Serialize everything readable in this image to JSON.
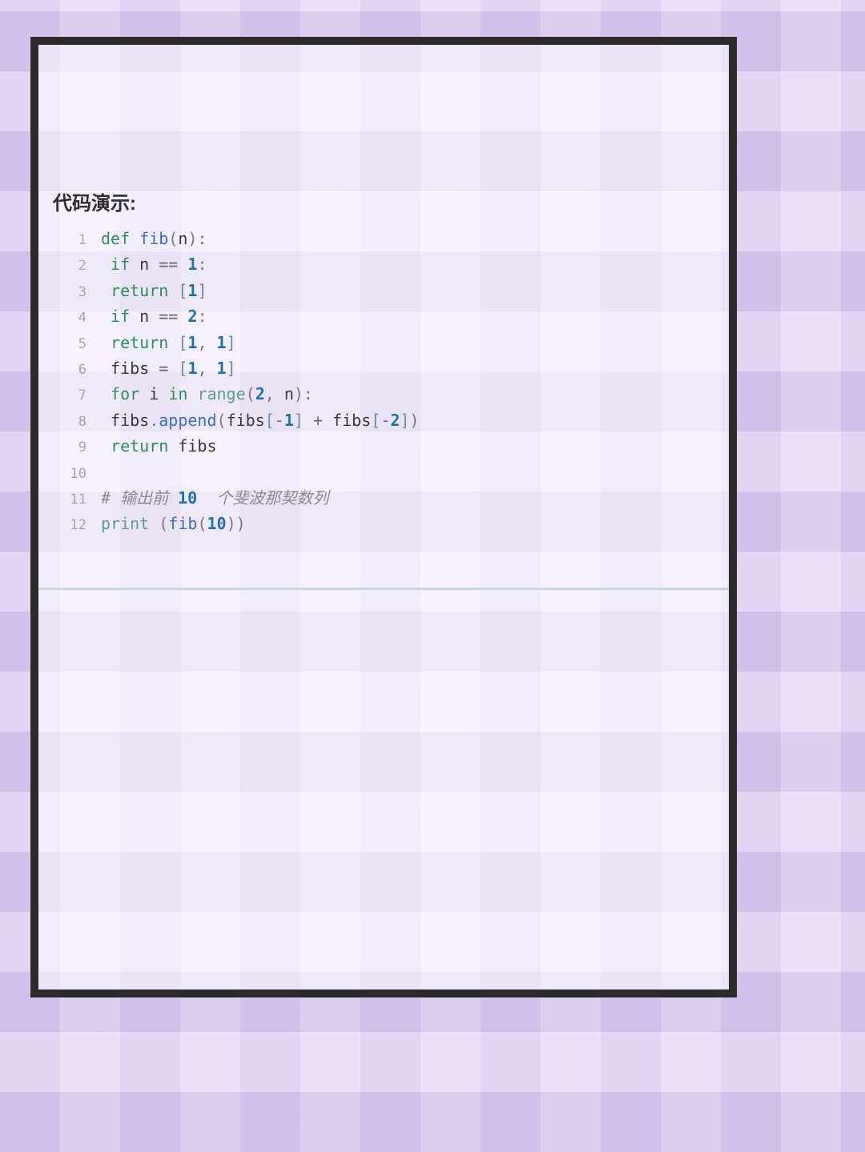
{
  "heading": "代码演示:",
  "code": {
    "line_numbers": [
      "1",
      "2",
      "3",
      "4",
      "5",
      "6",
      "7",
      "8",
      "9",
      "10",
      "11",
      "12"
    ],
    "lines": [
      [
        {
          "cls": "tok-kw",
          "t": "def "
        },
        {
          "cls": "tok-fn",
          "t": "fib"
        },
        {
          "cls": "tok-pun",
          "t": "("
        },
        {
          "cls": "tok-var",
          "t": "n"
        },
        {
          "cls": "tok-pun",
          "t": "):"
        }
      ],
      [
        {
          "cls": "",
          "t": " "
        },
        {
          "cls": "tok-kw",
          "t": "if "
        },
        {
          "cls": "tok-var",
          "t": "n "
        },
        {
          "cls": "tok-op",
          "t": "== "
        },
        {
          "cls": "tok-num",
          "t": "1"
        },
        {
          "cls": "tok-pun",
          "t": ":"
        }
      ],
      [
        {
          "cls": "",
          "t": " "
        },
        {
          "cls": "tok-kw",
          "t": "return "
        },
        {
          "cls": "tok-br",
          "t": "["
        },
        {
          "cls": "tok-num",
          "t": "1"
        },
        {
          "cls": "tok-br",
          "t": "]"
        }
      ],
      [
        {
          "cls": "",
          "t": " "
        },
        {
          "cls": "tok-kw",
          "t": "if "
        },
        {
          "cls": "tok-var",
          "t": "n "
        },
        {
          "cls": "tok-op",
          "t": "== "
        },
        {
          "cls": "tok-num",
          "t": "2"
        },
        {
          "cls": "tok-pun",
          "t": ":"
        }
      ],
      [
        {
          "cls": "",
          "t": " "
        },
        {
          "cls": "tok-kw",
          "t": "return "
        },
        {
          "cls": "tok-br",
          "t": "["
        },
        {
          "cls": "tok-num",
          "t": "1"
        },
        {
          "cls": "tok-pun",
          "t": ", "
        },
        {
          "cls": "tok-num",
          "t": "1"
        },
        {
          "cls": "tok-br",
          "t": "]"
        }
      ],
      [
        {
          "cls": "",
          "t": " "
        },
        {
          "cls": "tok-var",
          "t": "fibs "
        },
        {
          "cls": "tok-op",
          "t": "= "
        },
        {
          "cls": "tok-br",
          "t": "["
        },
        {
          "cls": "tok-num",
          "t": "1"
        },
        {
          "cls": "tok-pun",
          "t": ", "
        },
        {
          "cls": "tok-num",
          "t": "1"
        },
        {
          "cls": "tok-br",
          "t": "]"
        }
      ],
      [
        {
          "cls": "",
          "t": " "
        },
        {
          "cls": "tok-kw",
          "t": "for "
        },
        {
          "cls": "tok-var",
          "t": "i "
        },
        {
          "cls": "tok-kw",
          "t": "in "
        },
        {
          "cls": "tok-bi",
          "t": "range"
        },
        {
          "cls": "tok-pun",
          "t": "("
        },
        {
          "cls": "tok-num",
          "t": "2"
        },
        {
          "cls": "tok-pun",
          "t": ", "
        },
        {
          "cls": "tok-var",
          "t": "n"
        },
        {
          "cls": "tok-pun",
          "t": "):"
        }
      ],
      [
        {
          "cls": "",
          "t": " "
        },
        {
          "cls": "tok-var",
          "t": "fibs"
        },
        {
          "cls": "tok-pun",
          "t": "."
        },
        {
          "cls": "tok-fn",
          "t": "append"
        },
        {
          "cls": "tok-pun",
          "t": "("
        },
        {
          "cls": "tok-var",
          "t": "fibs"
        },
        {
          "cls": "tok-br",
          "t": "["
        },
        {
          "cls": "tok-op",
          "t": "-"
        },
        {
          "cls": "tok-num",
          "t": "1"
        },
        {
          "cls": "tok-br",
          "t": "]"
        },
        {
          "cls": "tok-op",
          "t": " + "
        },
        {
          "cls": "tok-var",
          "t": "fibs"
        },
        {
          "cls": "tok-br",
          "t": "["
        },
        {
          "cls": "tok-op",
          "t": "-"
        },
        {
          "cls": "tok-num",
          "t": "2"
        },
        {
          "cls": "tok-br",
          "t": "]"
        },
        {
          "cls": "tok-pun",
          "t": ")"
        }
      ],
      [
        {
          "cls": "",
          "t": " "
        },
        {
          "cls": "tok-kw",
          "t": "return "
        },
        {
          "cls": "tok-var",
          "t": "fibs"
        }
      ],
      [
        {
          "cls": "",
          "t": " "
        }
      ],
      [
        {
          "cls": "tok-cmt",
          "t": "# 输出前 "
        },
        {
          "cls": "tok-num",
          "t": "10"
        },
        {
          "cls": "tok-cmt",
          "t": "  个斐波那契数列"
        }
      ],
      [
        {
          "cls": "tok-bi",
          "t": "print "
        },
        {
          "cls": "tok-pun",
          "t": "("
        },
        {
          "cls": "tok-fn",
          "t": "fib"
        },
        {
          "cls": "tok-pun",
          "t": "("
        },
        {
          "cls": "tok-num",
          "t": "10"
        },
        {
          "cls": "tok-pun",
          "t": "))"
        }
      ]
    ]
  }
}
